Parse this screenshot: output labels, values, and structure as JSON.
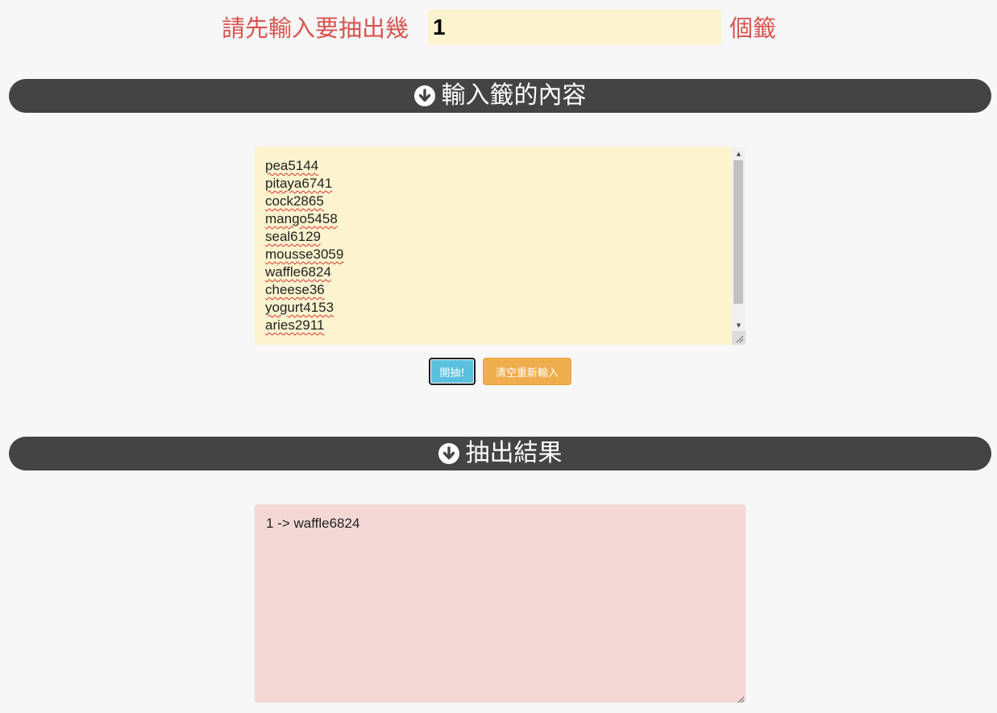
{
  "header": {
    "prompt_prefix": "請先輸入要抽出幾",
    "count_value": "1",
    "prompt_suffix": "個籤"
  },
  "input_section": {
    "title": "輸入籤的內容",
    "icon": "arrow-circle-down-icon",
    "lines": [
      "pea5144",
      "pitaya6741",
      "cock2865",
      "mango5458",
      "seal6129",
      "mousse3059",
      "waffle6824",
      "cheese36",
      "yogurt4153",
      "aries2911"
    ]
  },
  "buttons": {
    "draw_label": "開抽!",
    "clear_label": "清空重新輸入"
  },
  "result_section": {
    "title": "抽出結果",
    "icon": "arrow-circle-down-icon",
    "text": "1 -> waffle6824"
  },
  "colors": {
    "page_background": "#f7f7f7",
    "prompt_text": "#d9534f",
    "input_background": "#fcf3cf",
    "section_bar": "#444444",
    "draw_button": "#5bc0de",
    "clear_button": "#f0ad4e",
    "result_background": "#f2d7d5"
  }
}
